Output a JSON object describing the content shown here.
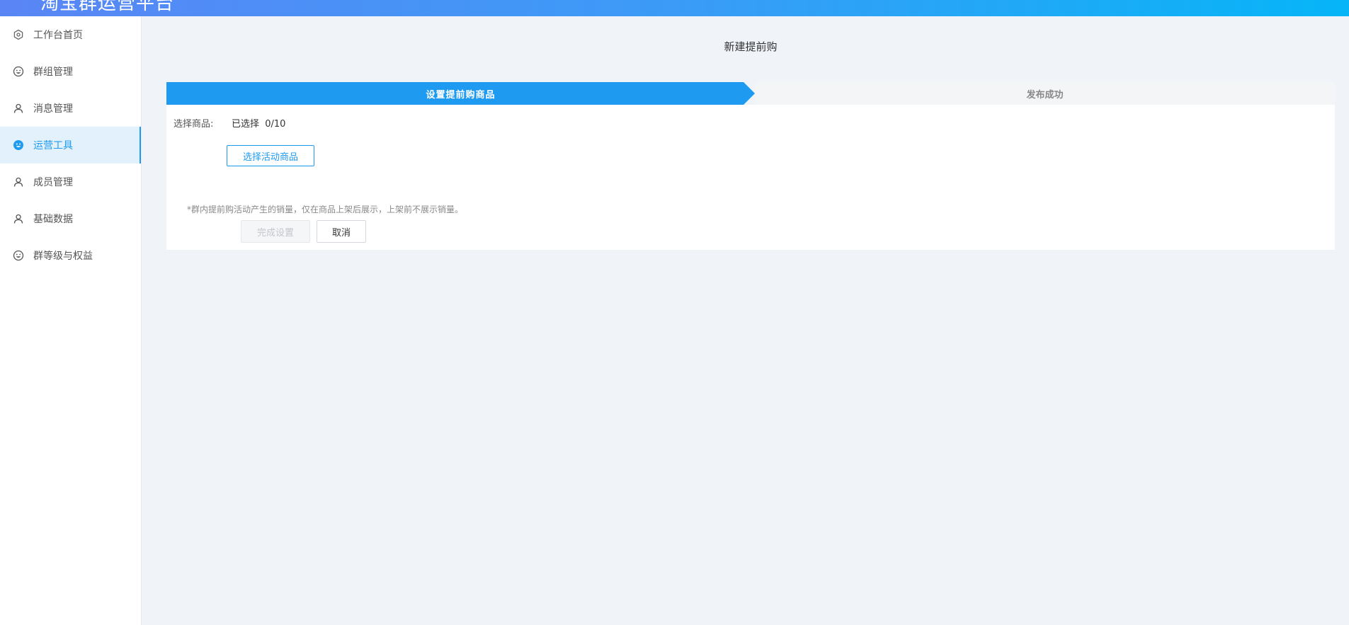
{
  "header": {
    "title": "淘宝群运营平台"
  },
  "sidebar": {
    "items": [
      {
        "label": "工作台首页",
        "icon": "hexagon-icon",
        "active": false
      },
      {
        "label": "群组管理",
        "icon": "smiley-icon",
        "active": false
      },
      {
        "label": "消息管理",
        "icon": "user-icon",
        "active": false
      },
      {
        "label": "运营工具",
        "icon": "smiley-icon",
        "active": true
      },
      {
        "label": "成员管理",
        "icon": "user-icon",
        "active": false
      },
      {
        "label": "基础数据",
        "icon": "user-icon",
        "active": false
      },
      {
        "label": "群等级与权益",
        "icon": "smiley-icon",
        "active": false
      }
    ]
  },
  "main": {
    "title": "新建提前购",
    "steps": [
      {
        "label": "设置提前购商品",
        "active": true
      },
      {
        "label": "发布成功",
        "active": false
      }
    ],
    "form": {
      "select_label": "选择商品:",
      "selected_text": "已选择  0/10",
      "select_button": "选择活动商品",
      "hint": "*群内提前购活动产生的销量，仅在商品上架后展示，上架前不展示销量。",
      "submit_button": "完成设置",
      "cancel_button": "取消"
    }
  },
  "colors": {
    "accent": "#1e9bf0",
    "header_gradient_start": "#5a86f5",
    "header_gradient_end": "#06b5f7"
  }
}
